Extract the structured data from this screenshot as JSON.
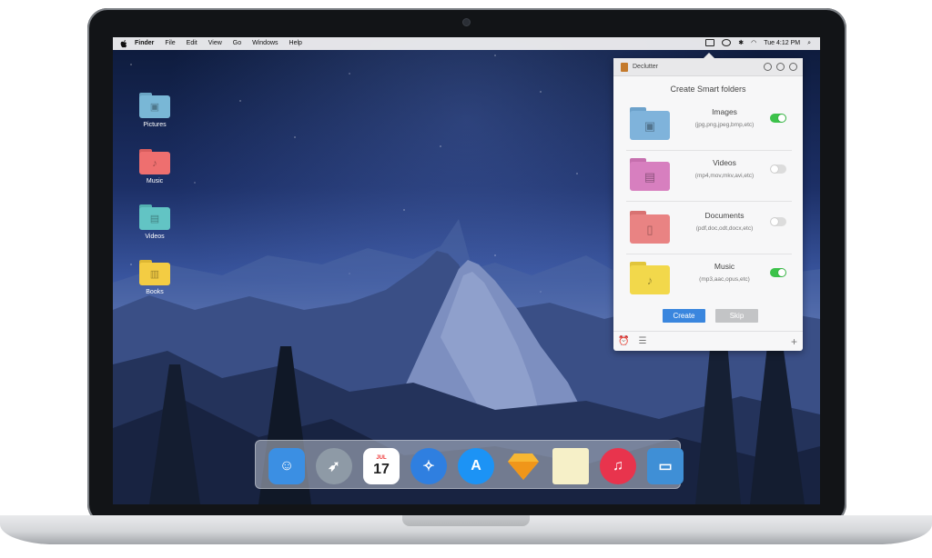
{
  "menubar": {
    "app": "Finder",
    "items": [
      "File",
      "Edit",
      "View",
      "Go",
      "Windows",
      "Help"
    ],
    "clock": "Tue 4:12 PM",
    "icons": [
      "apple-logo",
      "declutter-icon",
      "check-circle-icon",
      "bluetooth-icon",
      "wifi-icon",
      "search-icon"
    ]
  },
  "desktop": {
    "icons": [
      {
        "label": "Pictures",
        "color": "#79b7d6",
        "glyph": "image-icon"
      },
      {
        "label": "Music",
        "color": "#ee6f6f",
        "glyph": "music-note-icon"
      },
      {
        "label": "Videos",
        "color": "#62c4c4",
        "glyph": "film-icon"
      },
      {
        "label": "Books",
        "color": "#f3cc43",
        "glyph": "books-icon"
      }
    ]
  },
  "popover": {
    "app_title": "Declutter",
    "heading": "Create Smart folders",
    "rows": [
      {
        "name": "Images",
        "ext": "(jpg,png,jpeg,bmp,etc)",
        "enabled": true,
        "color": "#7fb3db"
      },
      {
        "name": "Videos",
        "ext": "(mp4,mov,mkv,avi,etc)",
        "enabled": false,
        "color": "#d77fbf"
      },
      {
        "name": "Documents",
        "ext": "(pdf,doc,odt,docx,etc)",
        "enabled": false,
        "color": "#e98383"
      },
      {
        "name": "Music",
        "ext": "(mp3,aac,opus,etc)",
        "enabled": true,
        "color": "#f2d84b"
      }
    ],
    "create_label": "Create",
    "skip_label": "Skip",
    "colors": {
      "toggle_on": "#3cc24a",
      "create": "#3a86de",
      "skip": "#c3c4c6"
    }
  },
  "dock": {
    "apps": [
      {
        "name": "finder-app",
        "color": "#3b8fe3"
      },
      {
        "name": "launchpad-app",
        "color": "#8e9aa6"
      },
      {
        "name": "calendar-app",
        "color": "#ffffff",
        "month": "JUL",
        "day": "17"
      },
      {
        "name": "safari-app",
        "color": "#2f7fe0"
      },
      {
        "name": "app-store-app",
        "color": "#1c93f5"
      },
      {
        "name": "sketch-app",
        "color": "#f7b733"
      },
      {
        "name": "notes-app",
        "color": "#f6f0c8"
      },
      {
        "name": "itunes-app",
        "color": "#e8344d"
      },
      {
        "name": "keynote-app",
        "color": "#3f8fd6"
      }
    ]
  }
}
